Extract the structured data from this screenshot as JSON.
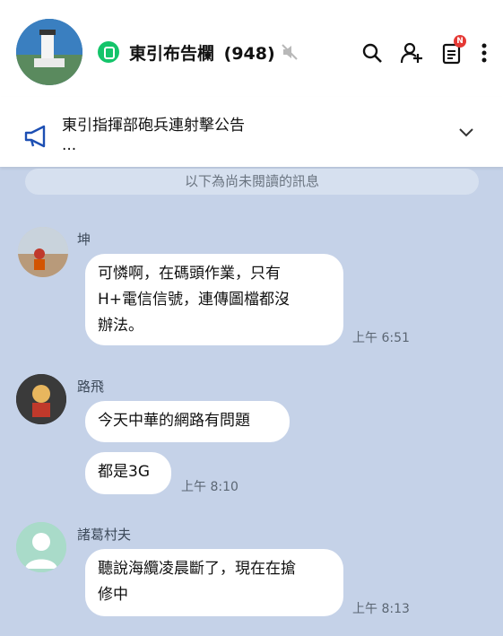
{
  "header": {
    "group_name": "東引布告欄",
    "member_count": "(948)",
    "notif_badge": "N",
    "icons": [
      "search-icon",
      "add-friend-icon",
      "notes-icon",
      "more-icon",
      "mute-icon"
    ]
  },
  "announcement": {
    "text": "東引指揮部砲兵連射擊公告",
    "ellipsis": "..."
  },
  "unread_divider": "以下為尚未閱讀的訊息",
  "messages": [
    {
      "sender": "坤",
      "bubbles": [
        "可憐啊，在碼頭作業，只有\nH+電信信號，連傳圖檔都沒\n辦法。"
      ],
      "time": "上午 6:51"
    },
    {
      "sender": "路飛",
      "bubbles": [
        "今天中華的網路有問題",
        "都是3G"
      ],
      "time": "上午 8:10"
    },
    {
      "sender": "諸葛村夫",
      "bubbles": [
        "聽說海纜凌晨斷了，現在在搶\n修中"
      ],
      "time": "上午 8:13"
    }
  ],
  "colors": {
    "background": "#c5d2e8",
    "accent_green": "#14c46a",
    "badge_red": "#e53935"
  }
}
